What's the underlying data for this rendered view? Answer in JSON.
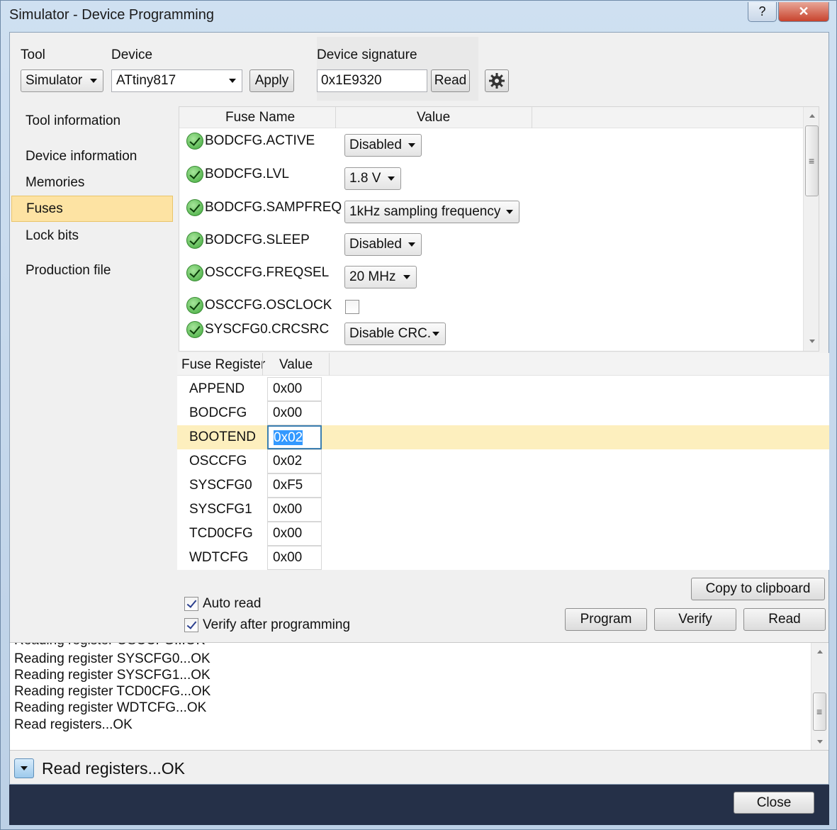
{
  "window": {
    "title": "Simulator - Device Programming",
    "help_label": "?",
    "close_glyph": "✕"
  },
  "toolbar": {
    "tool_label": "Tool",
    "tool_value": "Simulator",
    "device_label": "Device",
    "device_value": "ATtiny817",
    "apply_label": "Apply",
    "signature_label": "Device signature",
    "signature_value": "0x1E9320",
    "read_label": "Read",
    "settings_icon": "gear-icon"
  },
  "nav": {
    "items": [
      {
        "label": "Tool information"
      },
      {
        "label": "Device information"
      },
      {
        "label": "Memories"
      },
      {
        "label": "Fuses"
      },
      {
        "label": "Lock bits"
      },
      {
        "label": "Production file"
      }
    ],
    "active_index": 3
  },
  "fuses": {
    "col_name": "Fuse Name",
    "col_value": "Value",
    "rows": [
      {
        "name": "BODCFG.ACTIVE",
        "value": "Disabled"
      },
      {
        "name": "BODCFG.LVL",
        "value": "1.8 V"
      },
      {
        "name": "BODCFG.SAMPFREQ",
        "value": "1kHz sampling frequency"
      },
      {
        "name": "BODCFG.SLEEP",
        "value": "Disabled"
      },
      {
        "name": "OSCCFG.FREQSEL",
        "value": "20 MHz"
      },
      {
        "name": "OSCCFG.OSCLOCK",
        "value": "",
        "checked": false
      },
      {
        "name": "SYSCFG0.CRCSRC",
        "value": "Disable CRC."
      }
    ]
  },
  "registers": {
    "col_name": "Fuse Register",
    "col_value": "Value",
    "rows": [
      {
        "name": "APPEND",
        "value": "0x00"
      },
      {
        "name": "BODCFG",
        "value": "0x00"
      },
      {
        "name": "BOOTEND",
        "value": "0x02"
      },
      {
        "name": "OSCCFG",
        "value": "0x02"
      },
      {
        "name": "SYSCFG0",
        "value": "0xF5"
      },
      {
        "name": "SYSCFG1",
        "value": "0x00"
      },
      {
        "name": "TCD0CFG",
        "value": "0x00"
      },
      {
        "name": "WDTCFG",
        "value": "0x00"
      }
    ],
    "selected_index": 2
  },
  "options": {
    "auto_read": "Auto read",
    "auto_read_checked": true,
    "verify_after": "Verify after programming",
    "verify_after_checked": true
  },
  "actions": {
    "copy": "Copy to clipboard",
    "program": "Program",
    "verify": "Verify",
    "read": "Read"
  },
  "log": {
    "lines": [
      "Reading register OSCCFG...OK",
      "Reading register SYSCFG0...OK",
      "Reading register SYSCFG1...OK",
      "Reading register TCD0CFG...OK",
      "Reading register WDTCFG...OK",
      "Read registers...OK"
    ]
  },
  "status": {
    "text": "Read registers...OK"
  },
  "footer": {
    "close_label": "Close"
  },
  "colors": {
    "accent_selected": "#fde3a3",
    "footer_bg": "#253048"
  }
}
